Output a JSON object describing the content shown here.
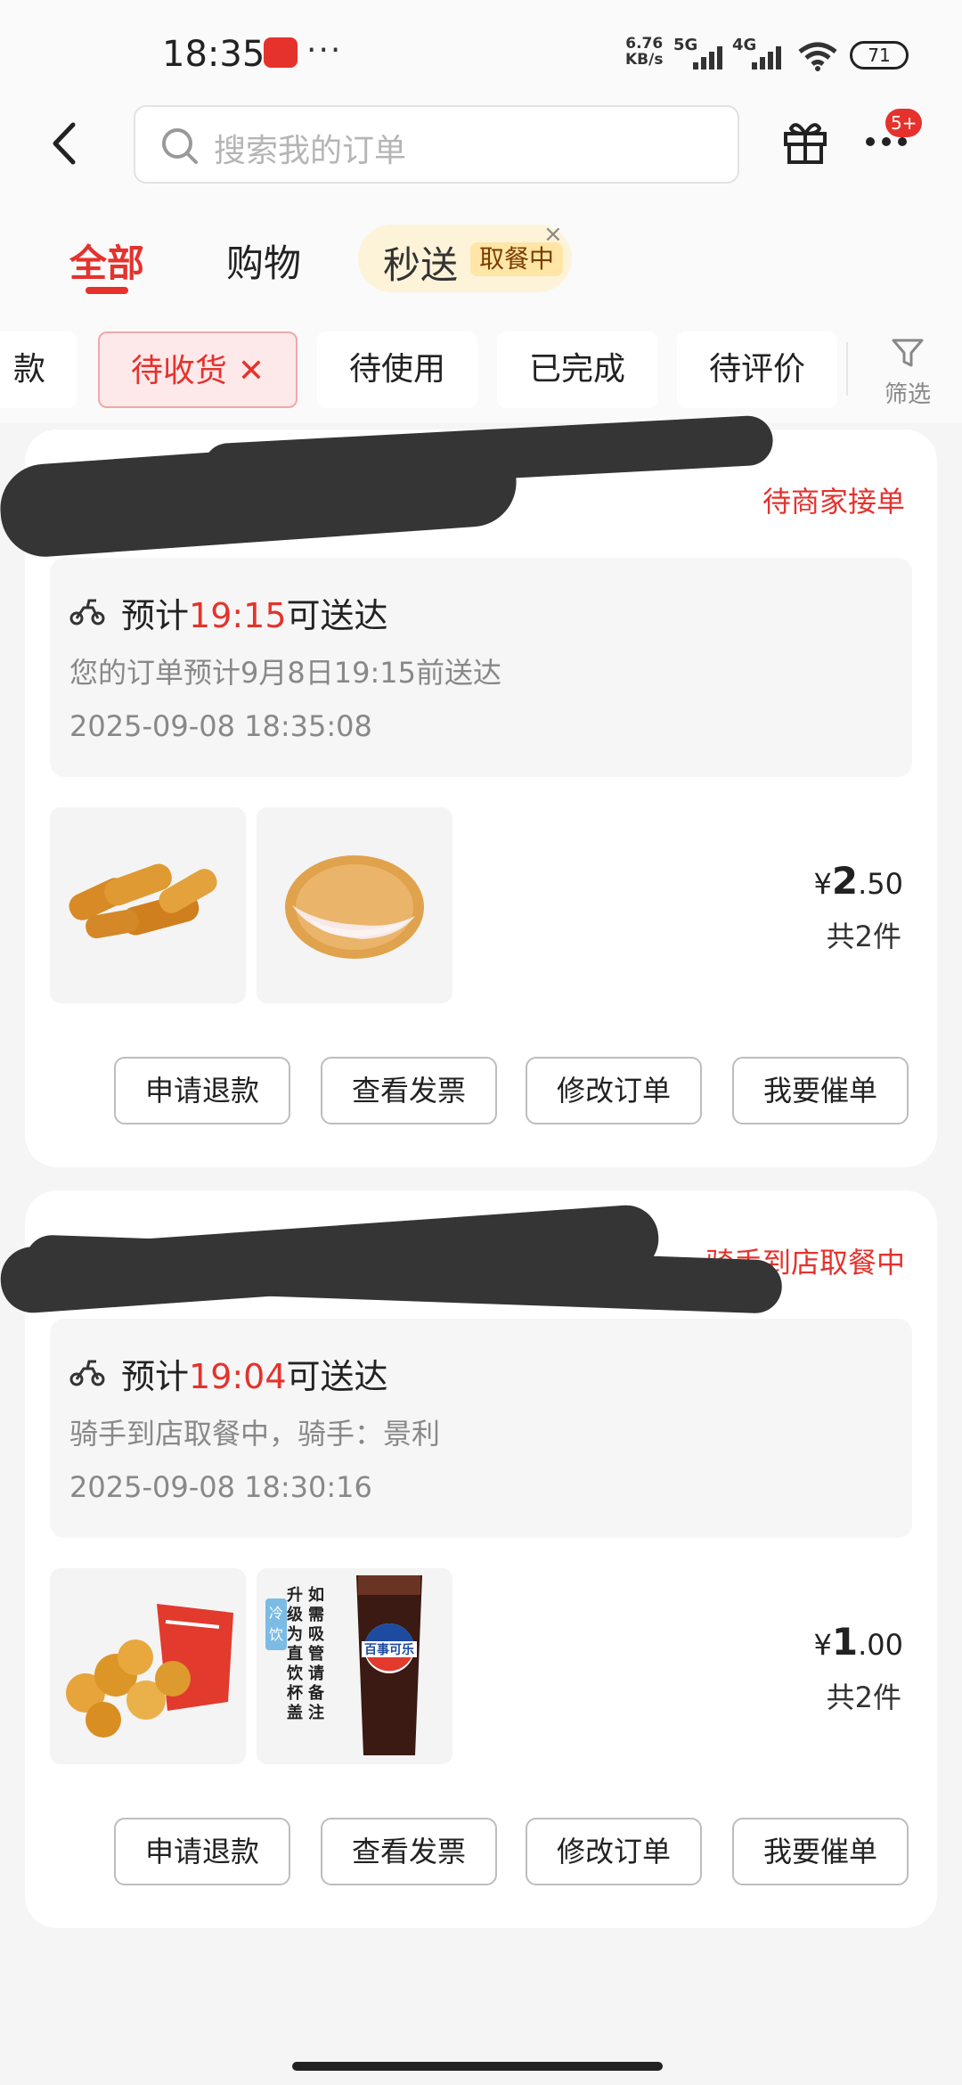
{
  "status_bar": {
    "time": "18:35",
    "more": "···",
    "speed_value": "6.76",
    "speed_unit": "KB/s",
    "net1": "5G",
    "net2": "4G",
    "battery": "71"
  },
  "header": {
    "search_placeholder": "搜索我的订单",
    "notification_badge": "5+"
  },
  "tabs": [
    {
      "label": "全部",
      "active": true
    },
    {
      "label": "购物",
      "active": false
    }
  ],
  "miaosong": {
    "label": "秒送",
    "tag": "取餐中",
    "close": "×"
  },
  "filters": {
    "chips": [
      {
        "label": "款"
      },
      {
        "label": "待收货",
        "active": true
      },
      {
        "label": "待使用"
      },
      {
        "label": "已完成"
      },
      {
        "label": "待评价"
      }
    ],
    "close_mark": "✕",
    "filter_label": "筛选"
  },
  "orders": [
    {
      "status": "待商家接单",
      "eta_prefix": "预计",
      "eta_time": "19:15",
      "eta_suffix": "可送达",
      "description": "您的订单预计9月8日19:15前送达",
      "timestamp": "2025-09-08 18:35:08",
      "price_symbol": "¥",
      "price_int": "2",
      "price_dec": ".50",
      "count": "共2件",
      "items": [
        "fried-chicken-strips",
        "chicken-fillet"
      ],
      "buttons": [
        "申请退款",
        "查看发票",
        "修改订单",
        "我要催单"
      ]
    },
    {
      "status": "骑手到店取餐中",
      "eta_prefix": "预计",
      "eta_time": "19:04",
      "eta_suffix": "可送达",
      "description": "骑手到店取餐中，骑手：景利",
      "timestamp": "2025-09-08 18:30:16",
      "price_symbol": "¥",
      "price_int": "1",
      "price_dec": ".00",
      "count": "共2件",
      "items": [
        "popcorn-chicken",
        "pepsi-cup"
      ],
      "item_texts": {
        "cold_tag": "冷饮",
        "cup_note_1": "如需吸管请备注",
        "cup_note_2": "升级为直饮杯盖",
        "brand": "百事可乐"
      },
      "buttons": [
        "申请退款",
        "查看发票",
        "修改订单",
        "我要催单"
      ]
    }
  ],
  "colors": {
    "accent": "#e5322d",
    "chip_active_bg": "#fde9e9",
    "miaosong_bg": "#fdf3d8"
  }
}
